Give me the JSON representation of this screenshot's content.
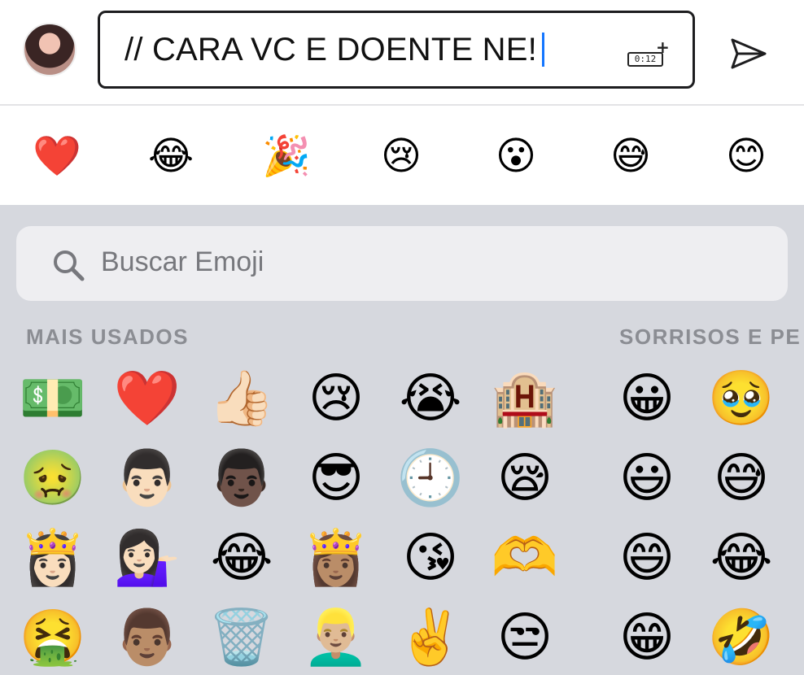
{
  "compose": {
    "message": "// CARA VC E DOENTE NE!",
    "gif_timer": "0:12"
  },
  "icons": {
    "avatar": "user-avatar",
    "gif": "gif-timer-icon",
    "send": "send-icon",
    "search": "search-icon"
  },
  "reactions": [
    "❤️",
    "😂",
    "🎉",
    "😢",
    "😮",
    "😅",
    "😊"
  ],
  "emoji_search": {
    "placeholder": "Buscar Emoji"
  },
  "sections": {
    "frequent": "MAIS USADOS",
    "smileys": "SORRISOS E PE"
  },
  "frequent_emojis": [
    [
      "💵",
      "❤️",
      "👍🏻",
      "😢",
      "😭",
      "🏨"
    ],
    [
      "🤢",
      "👨🏻",
      "👨🏿",
      "😎",
      "🕘",
      "😪"
    ],
    [
      "👸🏻",
      "💁🏻‍♀️",
      "😂",
      "👸🏽",
      "😘",
      "🫶"
    ],
    [
      "🤮",
      "👨🏽",
      "🗑️",
      "👱🏼‍♂️",
      "✌️",
      "😒"
    ]
  ],
  "smiley_emojis": [
    [
      "😀",
      "🥹"
    ],
    [
      "😃",
      "😅"
    ],
    [
      "😄",
      "😂"
    ],
    [
      "😁",
      "🤣"
    ]
  ],
  "colors": {
    "caret": "#1476ff",
    "keyboard_bg": "#d6d8de",
    "section_header": "#8b8d93"
  }
}
